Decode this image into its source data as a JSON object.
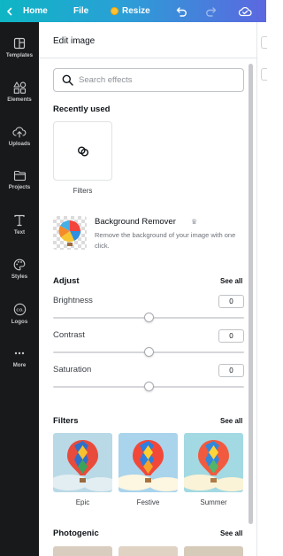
{
  "topbar": {
    "home_label": "Home",
    "file_label": "File",
    "resize_label": "Resize"
  },
  "rail": {
    "items": [
      {
        "label": "Templates",
        "icon": "templates-icon"
      },
      {
        "label": "Elements",
        "icon": "elements-icon"
      },
      {
        "label": "Uploads",
        "icon": "uploads-icon"
      },
      {
        "label": "Projects",
        "icon": "folder-icon"
      },
      {
        "label": "Text",
        "icon": "text-icon"
      },
      {
        "label": "Styles",
        "icon": "palette-icon"
      },
      {
        "label": "Logos",
        "icon": "logo-icon"
      },
      {
        "label": "More",
        "icon": "more-icon"
      }
    ]
  },
  "panel": {
    "title": "Edit image",
    "search_placeholder": "Search effects",
    "recently_used": {
      "heading": "Recently used",
      "items": [
        {
          "label": "Filters"
        }
      ]
    },
    "background_remover": {
      "title": "Background Remover",
      "description": "Remove the background of your image with one click."
    },
    "adjust": {
      "heading": "Adjust",
      "see_all": "See all",
      "controls": [
        {
          "label": "Brightness",
          "value": "0",
          "level": 0.5
        },
        {
          "label": "Contrast",
          "value": "0",
          "level": 0.5
        },
        {
          "label": "Saturation",
          "value": "0",
          "level": 0.5
        }
      ]
    },
    "filters": {
      "heading": "Filters",
      "see_all": "See all",
      "items": [
        {
          "label": "Epic"
        },
        {
          "label": "Festive"
        },
        {
          "label": "Summer"
        }
      ]
    },
    "photogenic": {
      "heading": "Photogenic",
      "see_all": "See all"
    }
  },
  "colors": {
    "rail_bg": "#18191b",
    "topbar_gradient_start": "#0eb5c4",
    "topbar_gradient_end": "#5c67e0",
    "premium_crown": "#ffc233"
  }
}
